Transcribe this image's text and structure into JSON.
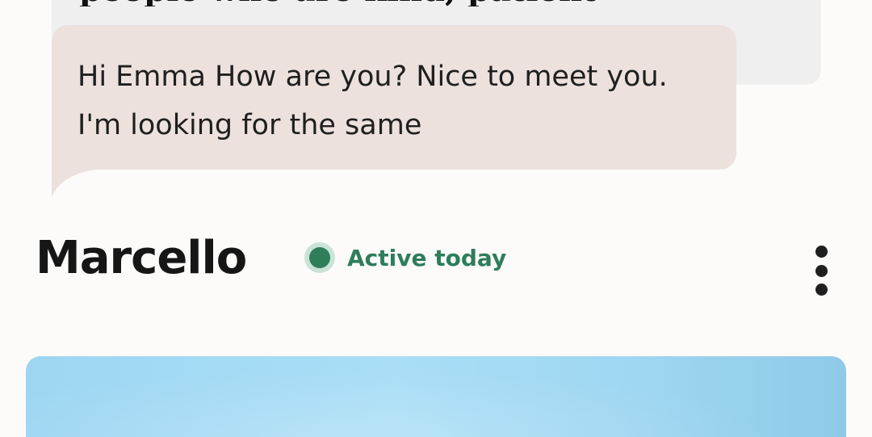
{
  "prompt": {
    "answer_text": "people who are kind, patient"
  },
  "message": {
    "text": "Hi Emma How are you? Nice to meet you. I'm looking for the same"
  },
  "profile": {
    "name": "Marcello",
    "status": "Active today",
    "status_color": "#2e7d5b"
  },
  "actions": {
    "more_icon": "more-vertical-icon"
  },
  "colors": {
    "background": "#fcfbfa",
    "prompt_card": "#efefef",
    "message_bubble": "#ede1de",
    "photo_sky": "#a9def6"
  }
}
